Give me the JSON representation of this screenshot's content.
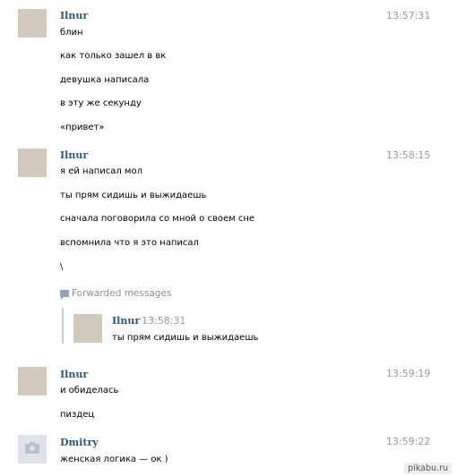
{
  "messages": [
    {
      "author": "Ilnur",
      "time": "13:57:31",
      "lines": [
        "блин",
        "как только зашел в вк",
        "девушка написала",
        "в эту же секунду",
        "«привет»"
      ]
    },
    {
      "author": "Ilnur",
      "time": "13:58:15",
      "lines": [
        "я ей написал мол",
        "ты прям сидишь и выжидаешь",
        "сначала поговорила со мной о своем сне",
        "вспомнила что я это написал",
        "\\"
      ],
      "forwarded": {
        "label": "Forwarded messages",
        "author": "Ilnur",
        "time": "13:58:31",
        "text": "ты прям сидишь и выжидаешь"
      }
    },
    {
      "author": "Ilnur",
      "time": "13:59:19",
      "lines": [
        "и обиделась",
        "пиздец"
      ]
    },
    {
      "author": "Dmitry",
      "time": "13:59:22",
      "lines": [
        "женская логика — ок )"
      ]
    }
  ],
  "watermark": "pikabu.ru",
  "icons": {
    "forward": "forward-icon",
    "camera": "camera-icon"
  }
}
